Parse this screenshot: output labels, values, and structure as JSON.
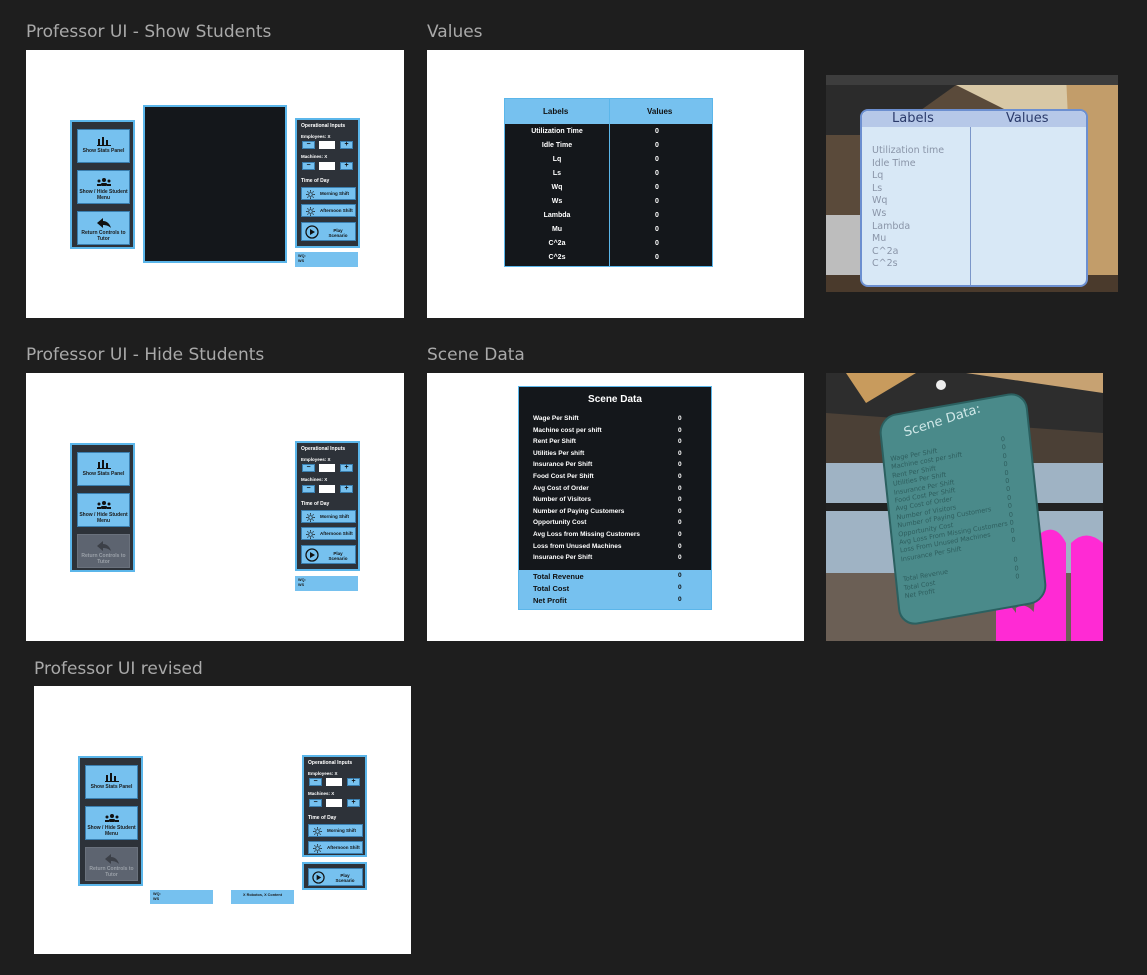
{
  "frames": {
    "show": "Professor UI - Show Students",
    "values": "Values",
    "hide": "Professor UI  - Hide Students",
    "scene": "Scene Data",
    "revised": "Professor UI  revised"
  },
  "controls": {
    "stats": "Show Stats Panel",
    "student_menu": "Show / Hide Student Menu",
    "return": "Return Controls to Tutor"
  },
  "ops": {
    "title": "Operational Inputs",
    "employees": "Employees: X",
    "machines": "Machines: X",
    "time": "Time of Day",
    "minus": "−",
    "plus": "+",
    "morning": "Morning Shift",
    "afternoon": "Afternoon Shift",
    "play": "Play Scenario"
  },
  "bars": {
    "wq": "WQ:",
    "ws": "WS",
    "counts": "X Robotos, X Content"
  },
  "values_table": {
    "labels_header": "Labels",
    "values_header": "Values",
    "rows": [
      {
        "label": "Utilization Time",
        "value": "0"
      },
      {
        "label": "Idle Time",
        "value": "0"
      },
      {
        "label": "Lq",
        "value": "0"
      },
      {
        "label": "Ls",
        "value": "0"
      },
      {
        "label": "Wq",
        "value": "0"
      },
      {
        "label": "Ws",
        "value": "0"
      },
      {
        "label": "Lambda",
        "value": "0"
      },
      {
        "label": "Mu",
        "value": "0"
      },
      {
        "label": "C^2a",
        "value": "0"
      },
      {
        "label": "C^2s",
        "value": "0"
      }
    ]
  },
  "scene_data": {
    "title": "Scene Data",
    "rows": [
      {
        "label": "Wage Per Shift",
        "value": "0"
      },
      {
        "label": "Machine cost per shift",
        "value": "0"
      },
      {
        "label": "Rent Per Shift",
        "value": "0"
      },
      {
        "label": "Utilities Per shift",
        "value": "0"
      },
      {
        "label": "Insurance Per Shift",
        "value": "0"
      },
      {
        "label": "Food Cost Per Shift",
        "value": "0"
      },
      {
        "label": "Avg Cost of Order",
        "value": "0"
      },
      {
        "label": "Number of Visitors",
        "value": "0"
      },
      {
        "label": "Number of Paying Customers",
        "value": "0"
      },
      {
        "label": "Opportunity Cost",
        "value": "0"
      },
      {
        "label": "Avg Loss from Missing Customers",
        "value": "0"
      },
      {
        "label": "Loss from Unused Machines",
        "value": "0"
      },
      {
        "label": "Insurance Per Shift",
        "value": "0"
      }
    ],
    "totals": [
      {
        "label": "Total Revenue",
        "value": "0"
      },
      {
        "label": "Total Cost",
        "value": "0"
      },
      {
        "label": "Net Profit",
        "value": "0"
      }
    ]
  },
  "shot1": {
    "labels": "Labels",
    "values": "Values",
    "rows": [
      "Utilization time",
      "Idle Time",
      "Lq",
      "Ls",
      "Wq",
      "Ws",
      "Lambda",
      "Mu",
      "C^2a",
      "C^2s"
    ]
  },
  "shot2": {
    "title": "Scene Data:",
    "rows": [
      "Wage Per Shift",
      "Machine cost per shift",
      "Rent Per Shift",
      "Utilities Per Shift",
      "Insurance Per Shift",
      "Food Cost Per Shift",
      "Avg Cost of Order",
      "Number of Visitors",
      "Number of Paying Customers",
      "Opportunity Cost",
      "Avg Loss From Missing Customers",
      "Loss From Unused Machines",
      "Insurance Per Shift"
    ],
    "totals": [
      "Total Revenue",
      "Total Cost",
      "Net Profit"
    ],
    "zero": "0"
  }
}
